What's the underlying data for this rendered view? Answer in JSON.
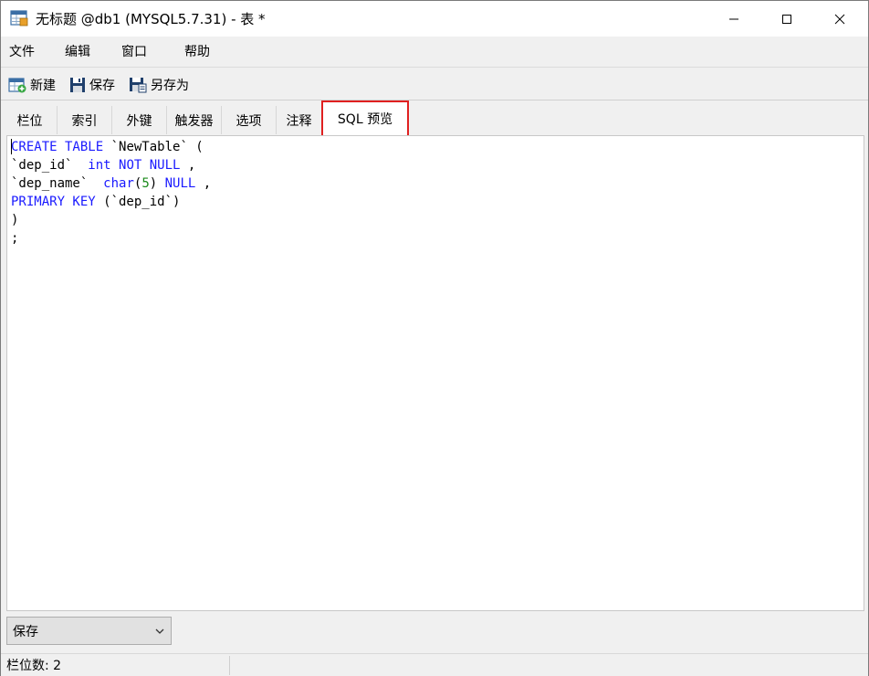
{
  "window": {
    "title": "无标题 @db1 (MYSQL5.7.31) - 表 *"
  },
  "menu": {
    "file": "文件",
    "edit": "编辑",
    "window": "窗口",
    "help": "帮助"
  },
  "toolbar": {
    "new_label": "新建",
    "save_label": "保存",
    "saveas_label": "另存为"
  },
  "tabs": {
    "fields": "栏位",
    "index": "索引",
    "foreign_keys": "外键",
    "triggers": "触发器",
    "options": "选项",
    "comment": "注释",
    "sql_preview": "SQL 预览"
  },
  "sql": {
    "line1": {
      "kw": "CREATE TABLE",
      "rest": " `NewTable` ("
    },
    "line2": {
      "ident": "`dep_id`  ",
      "kw": "int NOT NULL",
      "rest": " ,"
    },
    "line3": {
      "ident": "`dep_name`  ",
      "kw1": "char",
      "p1": "(",
      "num": "5",
      "p2": ")",
      "kw2": " NULL",
      "rest": " ,"
    },
    "line4": {
      "kw": "PRIMARY KEY",
      "rest": " (`dep_id`)"
    },
    "line5": ")",
    "line6": ";"
  },
  "bottom": {
    "save_select_value": "保存"
  },
  "status": {
    "field_count": "栏位数: 2"
  },
  "colors": {
    "keyword": "#1a1aff",
    "number": "#1a8a1a",
    "tab_highlight_border": "#e02020"
  },
  "icons": {
    "app": "table-window-icon",
    "new": "new-table-icon",
    "save": "floppy-disk-icon",
    "saveas": "save-as-icon",
    "minimize": "minimize-icon",
    "maximize": "maximize-icon",
    "close": "close-icon",
    "dropdown": "chevron-down-icon"
  }
}
